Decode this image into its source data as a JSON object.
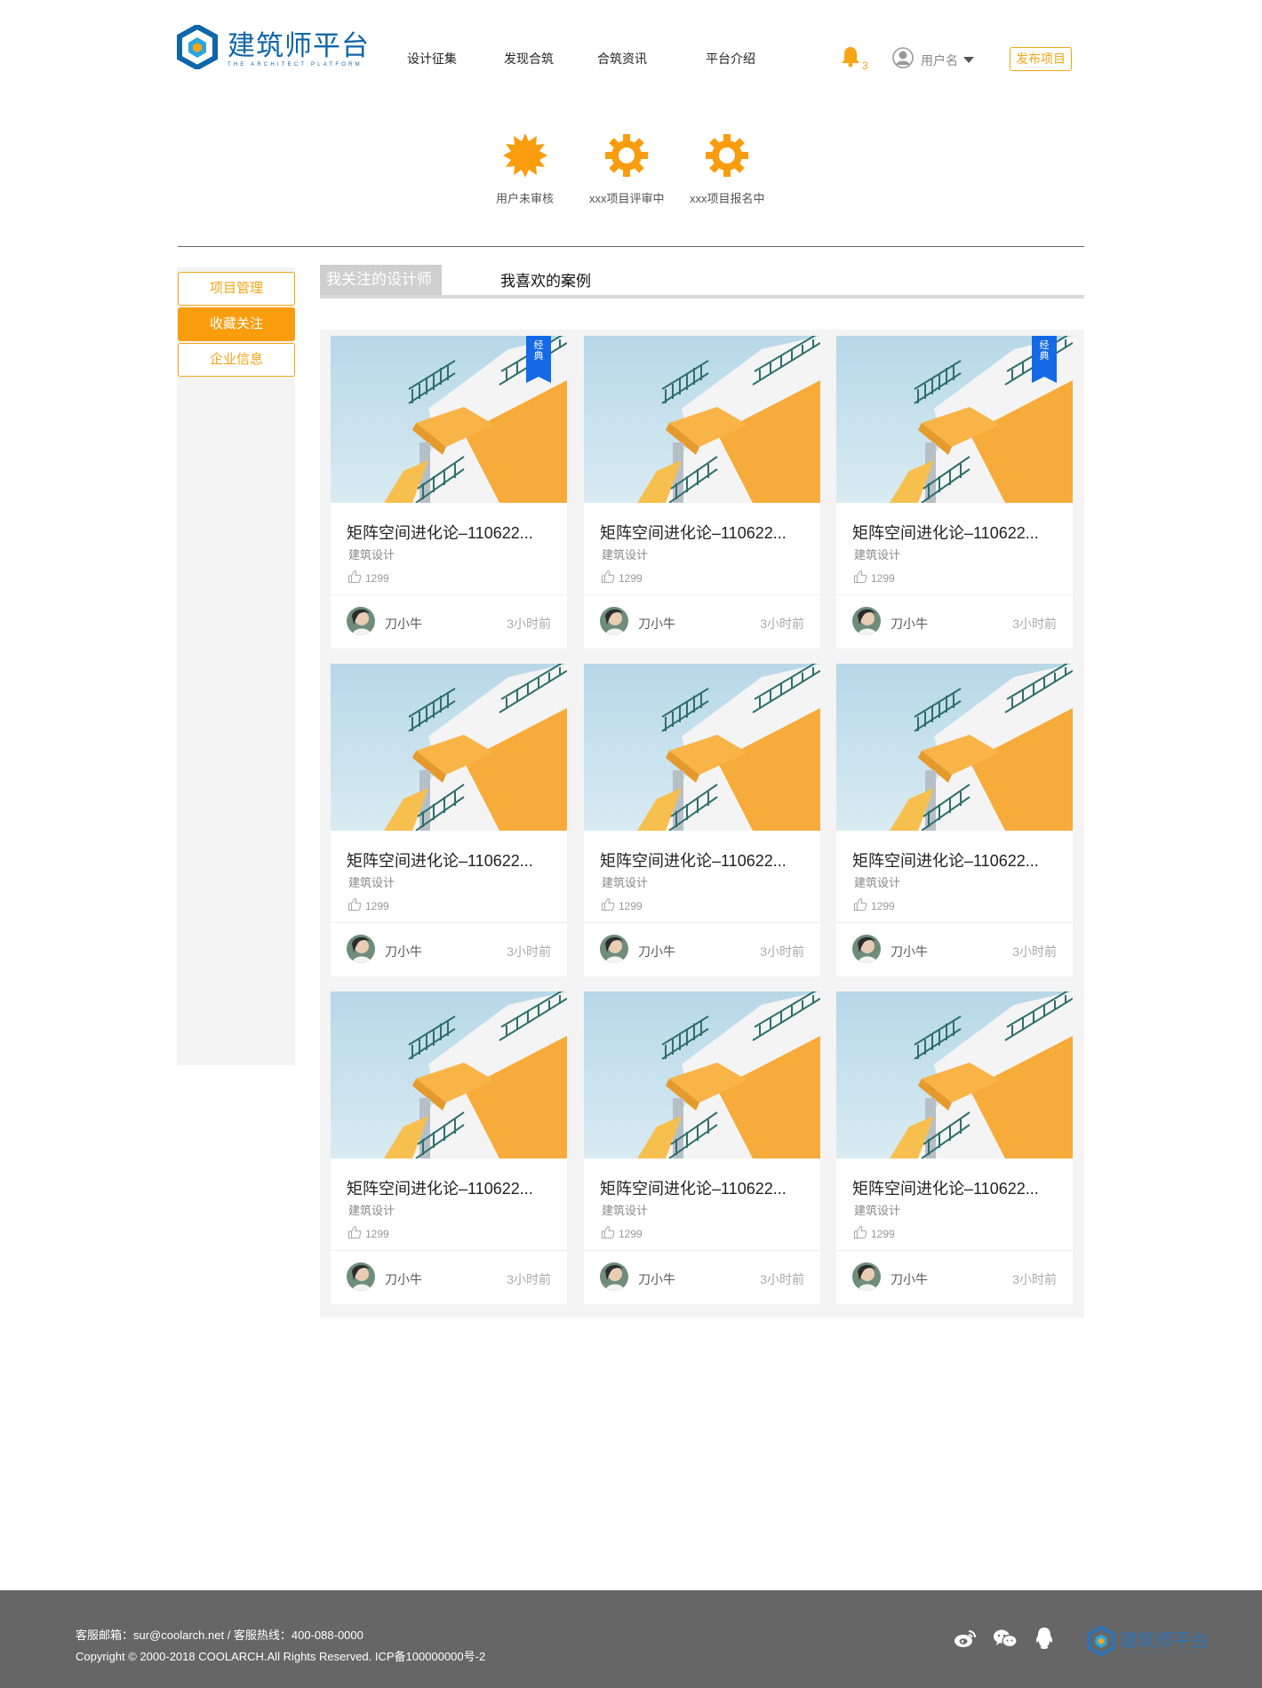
{
  "header": {
    "logo": {
      "name_cn": "建筑师平台",
      "name_en": "THE ARCHITECT PLATFORM"
    },
    "nav": [
      "设计征集",
      "发现合筑",
      "合筑资讯",
      "平台介绍"
    ],
    "notification_count": "3",
    "user_name": "用户名",
    "publish_label": "发布项目"
  },
  "status_items": [
    {
      "label": "用户未审核",
      "icon": "burst-badge-icon"
    },
    {
      "label": "xxx项目评审中",
      "icon": "gear-icon"
    },
    {
      "label": "xxx项目报名中",
      "icon": "gear-icon"
    }
  ],
  "sidebar": {
    "items": [
      {
        "label": "项目管理",
        "active": false
      },
      {
        "label": "收藏关注",
        "active": true
      },
      {
        "label": "企业信息",
        "active": false
      }
    ]
  },
  "tabs": {
    "active": "我关注的设计师",
    "other": "我喜欢的案例"
  },
  "cards": [
    {
      "title": "矩阵空间进化论–110622...",
      "category": "建筑设计",
      "likes": "1299",
      "author": "刀小牛",
      "time": "3小时前",
      "badge": "经典"
    },
    {
      "title": "矩阵空间进化论–110622...",
      "category": "建筑设计",
      "likes": "1299",
      "author": "刀小牛",
      "time": "3小时前",
      "badge": ""
    },
    {
      "title": "矩阵空间进化论–110622...",
      "category": "建筑设计",
      "likes": "1299",
      "author": "刀小牛",
      "time": "3小时前",
      "badge": "经典"
    },
    {
      "title": "矩阵空间进化论–110622...",
      "category": "建筑设计",
      "likes": "1299",
      "author": "刀小牛",
      "time": "3小时前",
      "badge": ""
    },
    {
      "title": "矩阵空间进化论–110622...",
      "category": "建筑设计",
      "likes": "1299",
      "author": "刀小牛",
      "time": "3小时前",
      "badge": ""
    },
    {
      "title": "矩阵空间进化论–110622...",
      "category": "建筑设计",
      "likes": "1299",
      "author": "刀小牛",
      "time": "3小时前",
      "badge": ""
    },
    {
      "title": "矩阵空间进化论–110622...",
      "category": "建筑设计",
      "likes": "1299",
      "author": "刀小牛",
      "time": "3小时前",
      "badge": ""
    },
    {
      "title": "矩阵空间进化论–110622...",
      "category": "建筑设计",
      "likes": "1299",
      "author": "刀小牛",
      "time": "3小时前",
      "badge": ""
    },
    {
      "title": "矩阵空间进化论–110622...",
      "category": "建筑设计",
      "likes": "1299",
      "author": "刀小牛",
      "time": "3小时前",
      "badge": ""
    }
  ],
  "footer": {
    "contact": "客服邮箱：sur@coolarch.net / 客服热线：400-088-0000",
    "copyright": "Copyright © 2000-2018 COOLARCH.All Rights Reserved.  ICP备100000000号-2",
    "social_icons": [
      "weibo-icon",
      "wechat-icon",
      "qq-icon"
    ],
    "logo_cn": "建筑师平台",
    "logo_en": "THE ARCHITECT PLATFORM"
  },
  "colors": {
    "accent": "#f99d0f",
    "brand_blue": "#0f66a9",
    "badge_blue": "#1469e6",
    "footer_bg": "#666666"
  }
}
